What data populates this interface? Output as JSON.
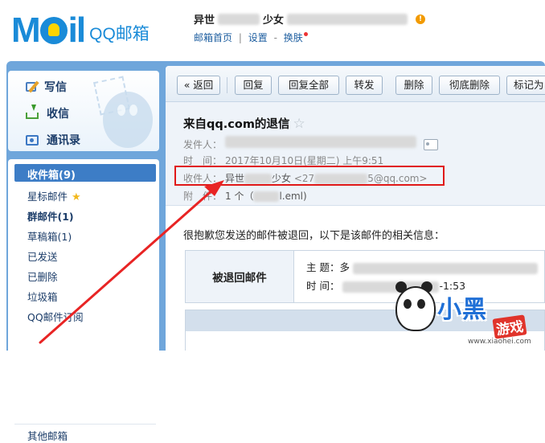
{
  "header": {
    "logo": "M il",
    "product_name": "QQ邮箱",
    "user_name_start": "异世",
    "user_name_mid": "少女",
    "status_icon": "!",
    "links": [
      "邮箱首页",
      "设置",
      "换肤"
    ],
    "link_sep": "|",
    "link_dash": "-"
  },
  "sidebar": {
    "actions": [
      {
        "label": "写信",
        "icon": "compose-icon"
      },
      {
        "label": "收信",
        "icon": "receive-icon"
      },
      {
        "label": "通讯录",
        "icon": "contacts-icon"
      }
    ],
    "folders": {
      "inbox": "收件箱(9)",
      "starred": "星标邮件",
      "group": "群邮件(1)",
      "drafts": "草稿箱(1)",
      "sent": "已发送",
      "deleted": "已删除",
      "spam": "垃圾箱",
      "subscriptions": "QQ邮件订阅",
      "other": "其他邮箱"
    }
  },
  "toolbar": {
    "back": "« 返回",
    "reply": "回复",
    "reply_all": "回复全部",
    "forward": "转发",
    "delete": "删除",
    "delete_permanently": "彻底删除",
    "mark": "标记为"
  },
  "mail": {
    "subject": "来自qq.com的退信",
    "star": "☆",
    "sender_label": "发件人：",
    "time_label": "时　间：",
    "time_value": "2017年10月10日(星期二) 上午9:51",
    "recipient_label": "收件人：",
    "recipient_name_start": "异世",
    "recipient_name_end": "少女",
    "recipient_email_start": "<27",
    "recipient_email_end": "5@qq.com>",
    "attachment_label": "附　件：",
    "attachment_count": "1 个（",
    "attachment_name_end": "l.eml)",
    "bounce_message": "很抱歉您发送的邮件被退回，以下是该邮件的相关信息：",
    "bounced_label": "被退回邮件",
    "subject_row_label": "主 题：多",
    "time_row_label": "时 间：",
    "time_row_tail": "-1:53"
  },
  "watermark": {
    "text": "小黑",
    "text2": "游戏",
    "url": "www.xiaohei.com"
  },
  "colors": {
    "brand_blue": "#1a8bd8",
    "frame_blue": "#6fa6db",
    "active_folder": "#3d7dc6",
    "highlight_red": "#e01818"
  }
}
